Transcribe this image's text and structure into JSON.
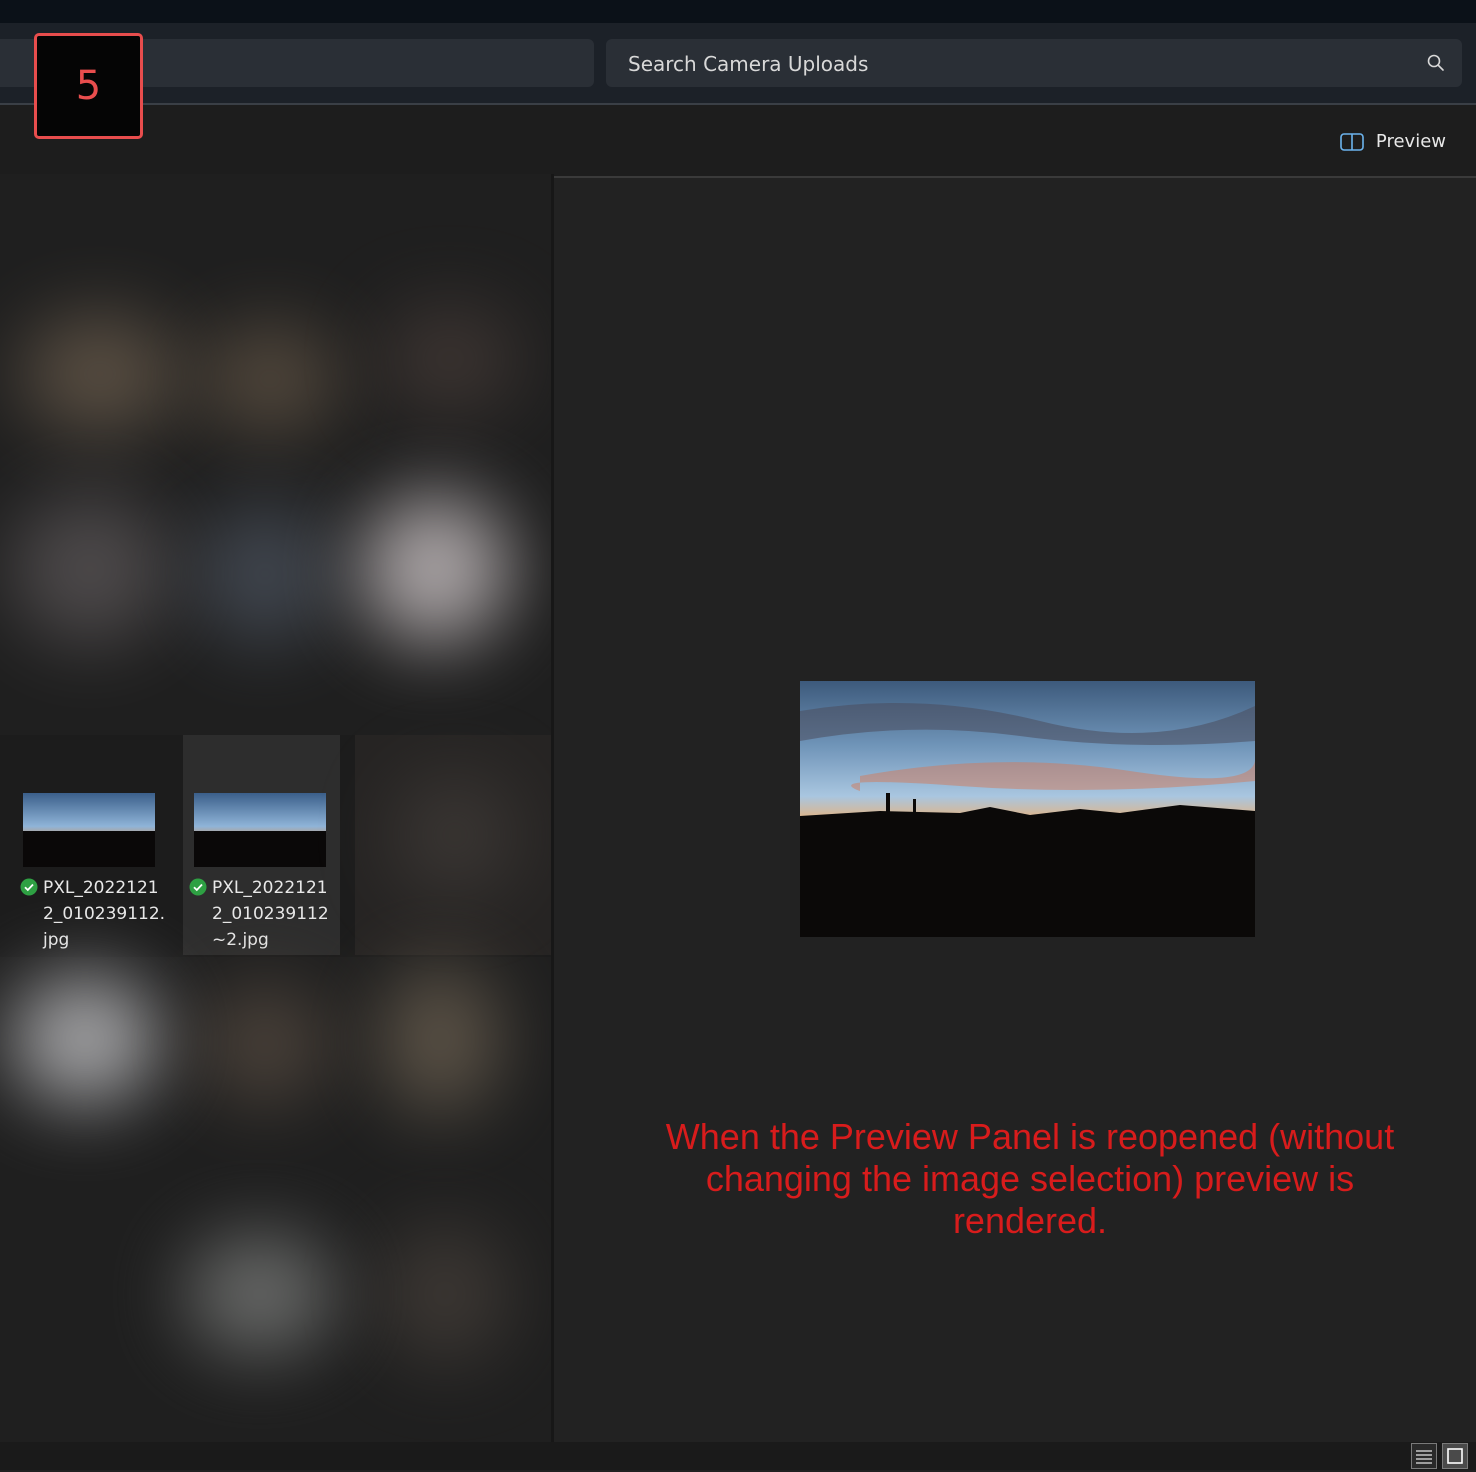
{
  "annotation_step": "5",
  "search": {
    "placeholder": "Search Camera Uploads"
  },
  "toolbar": {
    "preview_label": "Preview"
  },
  "files": [
    {
      "name": "PXL_20221212_010239112.jpg",
      "status": "synced",
      "selected": false
    },
    {
      "name": "PXL_20221212_010239112~2.jpg",
      "status": "synced",
      "selected": true
    }
  ],
  "annotation_note": "When the Preview Panel is reopened (without changing the image selection) preview is rendered.",
  "colors": {
    "annotation": "#d81c1c",
    "badge": "#e84d4d",
    "sync_ok": "#2ea043"
  }
}
